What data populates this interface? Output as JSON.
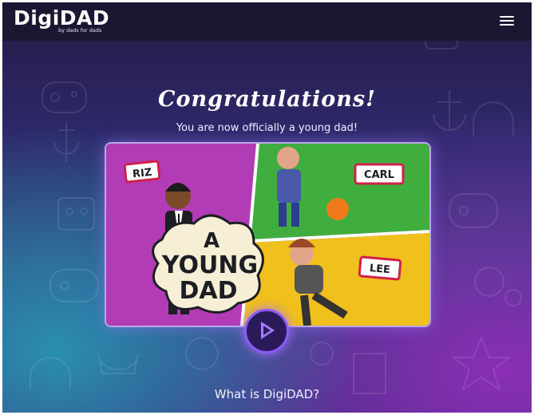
{
  "header": {
    "logo_text": "DigiDAD",
    "logo_tagline": "by dads for dads",
    "menu_icon": "hamburger-menu-icon"
  },
  "hero": {
    "title": "Congratulations!",
    "subtitle": "You are now officially a young dad!"
  },
  "video": {
    "characters": [
      "RIZ",
      "CARL",
      "LEE"
    ],
    "title_line1": "A",
    "title_line2": "YOUNG",
    "title_line3": "DAD",
    "play_icon": "play-icon"
  },
  "footer_link": "What is DigiDAD?",
  "colors": {
    "accent": "#8b5cf6",
    "panel_purple": "#b03cb0",
    "panel_green": "#3aa83a",
    "panel_yellow": "#f2c21a"
  }
}
